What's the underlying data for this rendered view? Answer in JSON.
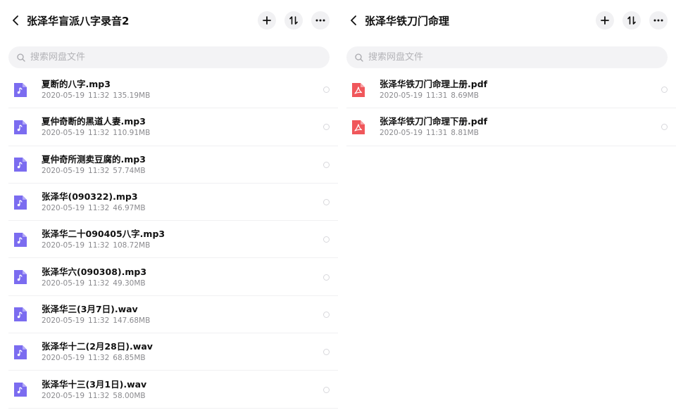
{
  "left_panel": {
    "title": "张泽华盲派八字录音2",
    "search_placeholder": "搜索网盘文件",
    "files": [
      {
        "name": "夏断的八字.mp3",
        "date": "2020-05-19",
        "time": "11:32",
        "size": "135.19MB",
        "type": "audio"
      },
      {
        "name": "夏仲奇断的黑道人妻.mp3",
        "date": "2020-05-19",
        "time": "11:32",
        "size": "110.91MB",
        "type": "audio"
      },
      {
        "name": "夏仲奇所测卖豆腐的.mp3",
        "date": "2020-05-19",
        "time": "11:32",
        "size": "57.74MB",
        "type": "audio"
      },
      {
        "name": "张泽华(090322).mp3",
        "date": "2020-05-19",
        "time": "11:32",
        "size": "46.97MB",
        "type": "audio"
      },
      {
        "name": "张泽华二十090405八字.mp3",
        "date": "2020-05-19",
        "time": "11:32",
        "size": "108.72MB",
        "type": "audio"
      },
      {
        "name": "张泽华六(090308).mp3",
        "date": "2020-05-19",
        "time": "11:32",
        "size": "49.30MB",
        "type": "audio"
      },
      {
        "name": "张泽华三(3月7日).wav",
        "date": "2020-05-19",
        "time": "11:32",
        "size": "147.68MB",
        "type": "audio"
      },
      {
        "name": "张泽华十二(2月28日).wav",
        "date": "2020-05-19",
        "time": "11:32",
        "size": "68.85MB",
        "type": "audio"
      },
      {
        "name": "张泽华十三(3月1日).wav",
        "date": "2020-05-19",
        "time": "11:32",
        "size": "58.00MB",
        "type": "audio"
      }
    ]
  },
  "right_panel": {
    "title": "张泽华铁刀门命理",
    "search_placeholder": "搜索网盘文件",
    "files": [
      {
        "name": "张泽华铁刀门命理上册.pdf",
        "date": "2020-05-19",
        "time": "11:31",
        "size": "8.69MB",
        "type": "pdf"
      },
      {
        "name": "张泽华铁刀门命理下册.pdf",
        "date": "2020-05-19",
        "time": "11:31",
        "size": "8.81MB",
        "type": "pdf"
      }
    ]
  },
  "icons": {
    "back": "chevron-left-icon",
    "add": "plus-icon",
    "sort": "sort-icon",
    "more": "more-icon",
    "search": "search-icon",
    "audio_file": "music-file-icon",
    "pdf_file": "pdf-file-icon"
  },
  "colors": {
    "audio_icon": "#7b6cf0",
    "pdf_icon": "#f0575b",
    "meta_text": "#8a8a8e",
    "search_bg": "#f3f3f5",
    "button_bg": "#f1f1f3"
  }
}
